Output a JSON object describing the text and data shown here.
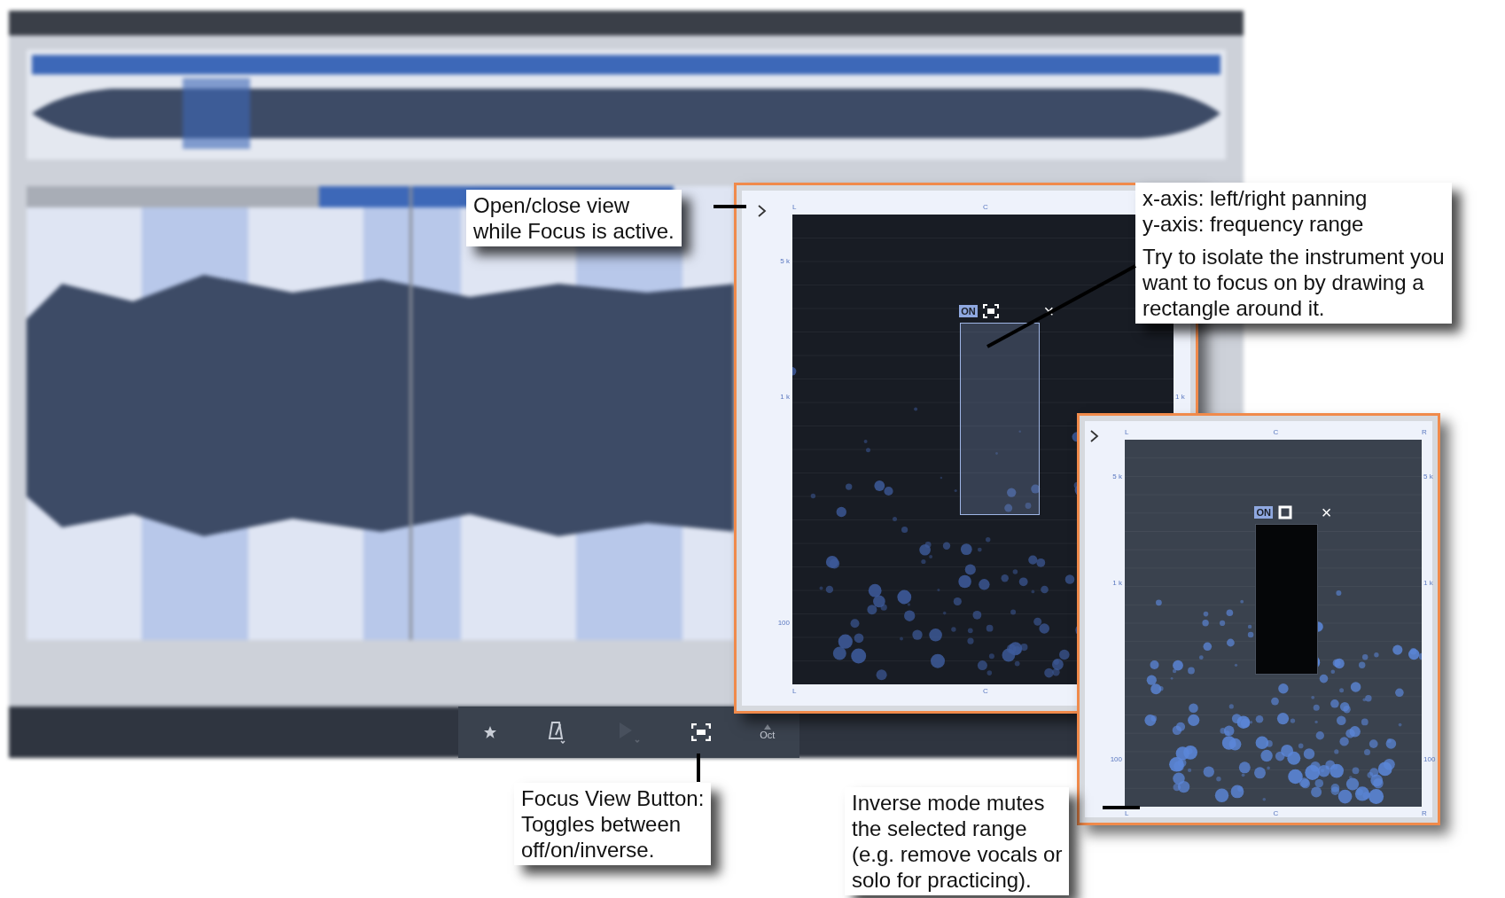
{
  "toolbar": [
    {
      "kind": "star",
      "disabled": false
    },
    {
      "kind": "metronome",
      "disabled": false
    },
    {
      "kind": "play",
      "disabled": true
    },
    {
      "kind": "focus",
      "disabled": false
    },
    {
      "kind": "octave",
      "label": "Oct",
      "disabled": false
    }
  ],
  "panels": [
    {
      "inverse": false,
      "badge": "ON",
      "close": "×",
      "top_labels": [
        "L",
        "C"
      ],
      "left_labels": [
        "5 k",
        "1 k",
        "100"
      ],
      "right_labels": [
        "1 k"
      ],
      "bottom_labels": [
        "L",
        "C"
      ]
    },
    {
      "inverse": true,
      "badge": "ON",
      "close": "×",
      "top_labels": [
        "L",
        "C",
        "R"
      ],
      "left_labels": [
        "5 k",
        "1 k",
        "100"
      ],
      "right_labels": [
        "5 k",
        "1 k",
        "100"
      ],
      "bottom_labels": [
        "L",
        "C",
        "R"
      ]
    }
  ],
  "callouts": [
    {
      "kind": "open-close",
      "paragraphs": [
        "Open/close view\nwhile Focus is active."
      ]
    },
    {
      "kind": "axes",
      "paragraphs": [
        "x-axis: left/right panning\ny-axis: frequency range",
        "Try to isolate the instrument you\nwant to focus on by drawing a\nrectangle around it."
      ]
    },
    {
      "kind": "focus-button",
      "paragraphs": [
        "Focus View Button:\nToggles between\noff/on/inverse."
      ]
    },
    {
      "kind": "inverse",
      "paragraphs": [
        "Inverse mode mutes\nthe selected range\n(e.g. remove vocals or\nsolo for practicing)."
      ]
    }
  ]
}
